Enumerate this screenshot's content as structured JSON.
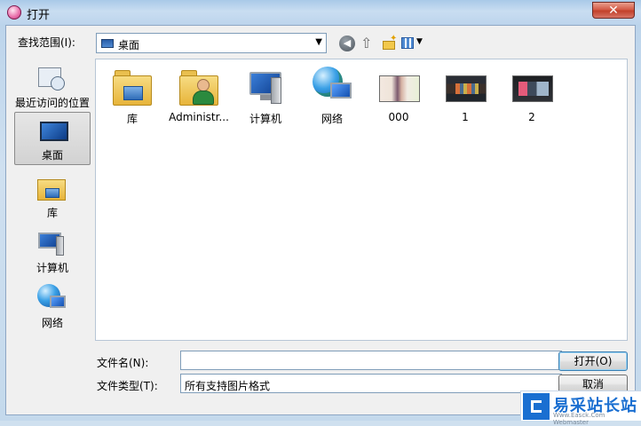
{
  "window": {
    "title": "打开",
    "close_label": "✕"
  },
  "toolbar": {
    "look_in_label": "查找范围(I):",
    "look_in_value": "桌面",
    "back_icon": "back-arrow-icon",
    "up_icon": "up-folder-icon",
    "new_folder_icon": "new-folder-icon",
    "views_icon": "views-menu-icon"
  },
  "places": [
    {
      "label": "最近访问的位置",
      "icon": "recent-places-icon"
    },
    {
      "label": "桌面",
      "icon": "desktop-icon",
      "selected": true
    },
    {
      "label": "库",
      "icon": "libraries-icon"
    },
    {
      "label": "计算机",
      "icon": "computer-icon"
    },
    {
      "label": "网络",
      "icon": "network-icon"
    }
  ],
  "items": [
    {
      "label": "库",
      "icon": "libraries-folder-icon"
    },
    {
      "label": "Administr...",
      "icon": "user-folder-icon"
    },
    {
      "label": "计算机",
      "icon": "computer-icon"
    },
    {
      "label": "网络",
      "icon": "network-icon"
    },
    {
      "label": "000",
      "icon": "image-thumbnail-icon"
    },
    {
      "label": "1",
      "icon": "image-thumbnail-icon"
    },
    {
      "label": "2",
      "icon": "image-thumbnail-icon"
    }
  ],
  "filename": {
    "label": "文件名(N):",
    "value": ""
  },
  "filetype": {
    "label": "文件类型(T):",
    "value": "所有支持图片格式"
  },
  "buttons": {
    "open": "打开(O)",
    "cancel": "取消"
  },
  "watermark": {
    "text": "易采站长站",
    "url": "Www.Easck.Com Webmaster"
  },
  "colors": {
    "titlebar": "#bcd4ec",
    "close_button": "#c2412b",
    "dialog_background": "#f0f0f0",
    "accent": "#1a6fd1"
  }
}
